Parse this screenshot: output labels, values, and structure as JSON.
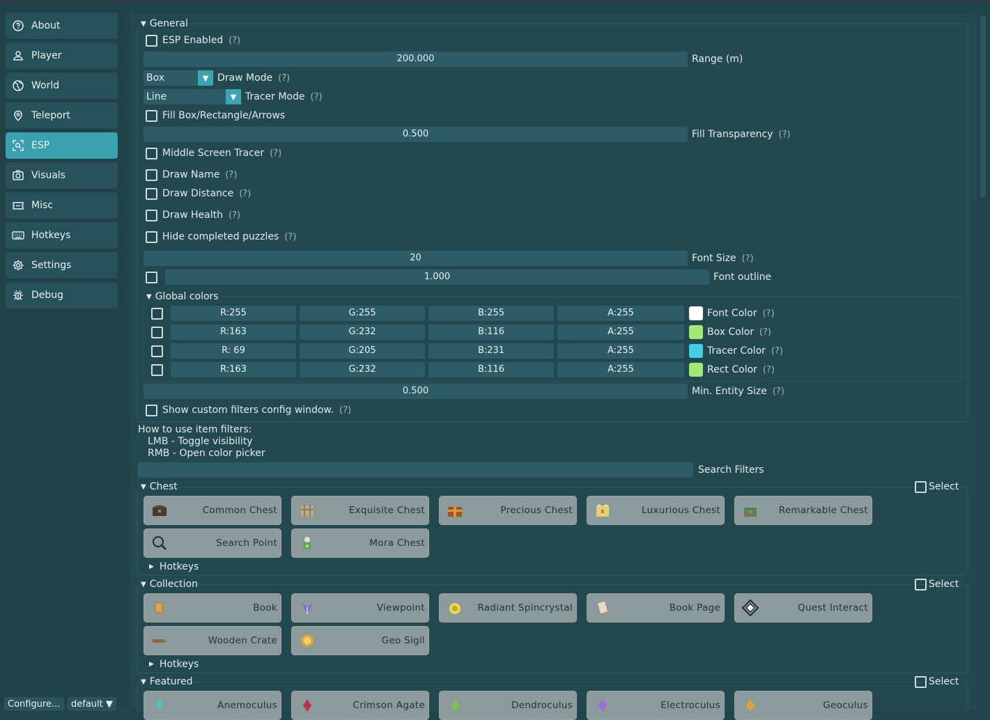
{
  "sidebar": {
    "items": [
      {
        "label": "About",
        "icon": "help-circle-icon",
        "active": false
      },
      {
        "label": "Player",
        "icon": "user-icon",
        "active": false
      },
      {
        "label": "World",
        "icon": "globe-icon",
        "active": false
      },
      {
        "label": "Teleport",
        "icon": "map-pin-icon",
        "active": false
      },
      {
        "label": "ESP",
        "icon": "scan-icon",
        "active": true
      },
      {
        "label": "Visuals",
        "icon": "camera-icon",
        "active": false
      },
      {
        "label": "Misc",
        "icon": "ticket-icon",
        "active": false
      },
      {
        "label": "Hotkeys",
        "icon": "keyboard-icon",
        "active": false
      },
      {
        "label": "Settings",
        "icon": "gear-icon",
        "active": false
      },
      {
        "label": "Debug",
        "icon": "bug-icon",
        "active": false
      }
    ],
    "footer": {
      "configure_label": "Configure...",
      "profile_label": "default ▼"
    }
  },
  "general": {
    "header": "General",
    "help": "(?)",
    "esp_enabled": "ESP Enabled",
    "range": {
      "value": "200.000",
      "label": "Range (m)"
    },
    "draw_mode": {
      "value": "Box",
      "label": "Draw Mode"
    },
    "tracer_mode": {
      "value": "Line",
      "label": "Tracer Mode"
    },
    "fill_box": "Fill Box/Rectangle/Arrows",
    "fill_transparency": {
      "value": "0.500",
      "label": "Fill Transparency"
    },
    "middle_tracer": "Middle Screen Tracer",
    "draw_name": "Draw Name",
    "draw_distance": "Draw Distance",
    "draw_health": "Draw Health",
    "hide_puzzles": "Hide completed puzzles",
    "font_size": {
      "value": "20",
      "label": "Font Size"
    },
    "font_outline": {
      "value": "1.000",
      "label": "Font outline"
    },
    "global_colors": {
      "header": "Global colors",
      "rows": [
        {
          "r": "R:255",
          "g": "G:255",
          "b": "B:255",
          "a": "A:255",
          "label": "Font Color",
          "color": "#ffffff"
        },
        {
          "r": "R:163",
          "g": "G:232",
          "b": "B:116",
          "a": "A:255",
          "label": "Box Color",
          "color": "#a3e874"
        },
        {
          "r": "R: 69",
          "g": "G:205",
          "b": "B:231",
          "a": "A:255",
          "label": "Tracer Color",
          "color": "#45cde7"
        },
        {
          "r": "R:163",
          "g": "G:232",
          "b": "B:116",
          "a": "A:255",
          "label": "Rect Color",
          "color": "#a3e874"
        }
      ]
    },
    "min_entity_size": {
      "value": "0.500",
      "label": "Min. Entity Size"
    },
    "custom_filters": "Show custom filters config window."
  },
  "filters_help": {
    "title": "How to use item filters:",
    "line1": "LMB - Toggle visibility",
    "line2": "RMB - Open color picker"
  },
  "search": {
    "label": "Search Filters",
    "value": ""
  },
  "select_label": "Select",
  "hotkeys_label": "Hotkeys",
  "categories": [
    {
      "header": "Chest",
      "items": [
        {
          "label": "Common Chest",
          "icon": "common-chest-icon"
        },
        {
          "label": "Exquisite Chest",
          "icon": "exquisite-chest-icon"
        },
        {
          "label": "Precious Chest",
          "icon": "precious-chest-icon"
        },
        {
          "label": "Luxurious Chest",
          "icon": "luxurious-chest-icon"
        },
        {
          "label": "Remarkable Chest",
          "icon": "remarkable-chest-icon"
        },
        {
          "label": "Search Point",
          "icon": "magnifier-icon"
        },
        {
          "label": "Mora Chest",
          "icon": "mora-chest-icon"
        }
      ]
    },
    {
      "header": "Collection",
      "items": [
        {
          "label": "Book",
          "icon": "book-icon"
        },
        {
          "label": "Viewpoint",
          "icon": "viewpoint-icon"
        },
        {
          "label": "Radiant Spincrystal",
          "icon": "spincrystal-icon"
        },
        {
          "label": "Book Page",
          "icon": "book-page-icon"
        },
        {
          "label": "Quest Interact",
          "icon": "quest-interact-icon"
        },
        {
          "label": "Wooden Crate",
          "icon": "wooden-crate-icon"
        },
        {
          "label": "Geo Sigil",
          "icon": "geo-sigil-icon"
        }
      ]
    },
    {
      "header": "Featured",
      "items": [
        {
          "label": "Anemoculus",
          "icon": "anemoculus-icon"
        },
        {
          "label": "Crimson Agate",
          "icon": "crimson-agate-icon"
        },
        {
          "label": "Dendroculus",
          "icon": "dendroculus-icon"
        },
        {
          "label": "Electroculus",
          "icon": "electroculus-icon"
        },
        {
          "label": "Geoculus",
          "icon": "geoculus-icon"
        }
      ]
    }
  ],
  "colors": {
    "accent": "#3aa0ad",
    "tile": "#8c9a9c",
    "panel": "#24484f",
    "widget": "#2d5c66"
  }
}
